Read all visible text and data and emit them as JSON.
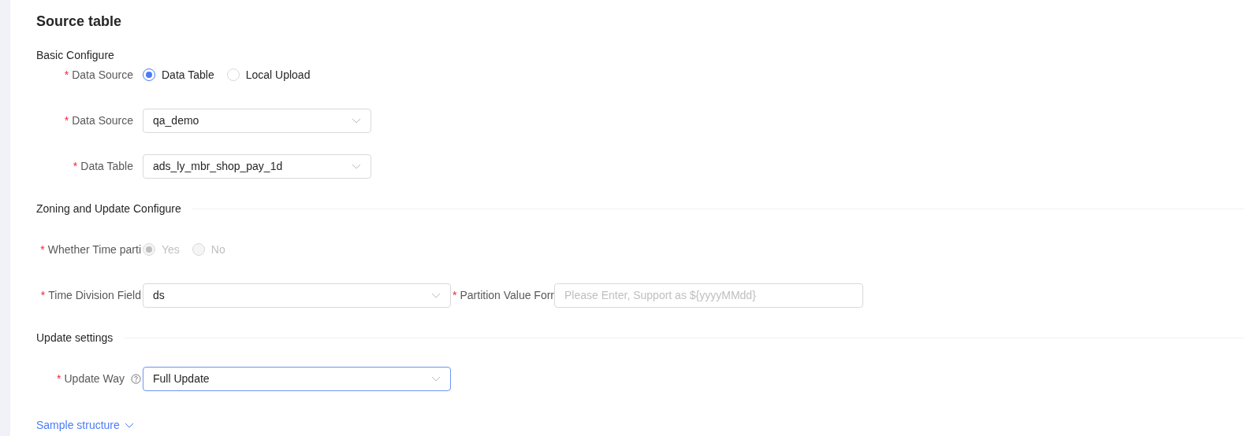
{
  "title": "Source table",
  "sections": [
    {
      "heading": "Basic Configure",
      "divider": false,
      "compact": true,
      "rows": [
        [
          {
            "kind": "radio",
            "label": "Data Source",
            "required": "*",
            "disabled": false,
            "options": [
              {
                "label": "Data Table",
                "selected": true
              },
              {
                "label": "Local Upload",
                "selected": false
              }
            ]
          }
        ],
        [
          {
            "kind": "select",
            "label": "Data Source",
            "required": "*",
            "value": "qa_demo",
            "focused": false
          }
        ],
        [
          {
            "kind": "select",
            "label": "Data Table",
            "required": "*",
            "value": "ads_ly_mbr_shop_pay_1d",
            "focused": false
          }
        ]
      ]
    },
    {
      "heading": "Zoning and Update Configure",
      "divider": true,
      "compact": false,
      "rows": [
        [
          {
            "kind": "radio",
            "label": "Whether Time parti",
            "required": "*",
            "disabled": true,
            "options": [
              {
                "label": "Yes",
                "selected": true
              },
              {
                "label": "No",
                "selected": false
              }
            ]
          }
        ],
        [
          {
            "kind": "select",
            "label": "Time Division Field",
            "required": "*",
            "value": "ds",
            "focused": false
          },
          {
            "kind": "input",
            "label": "Partition Value Forr",
            "required": "*",
            "placeholder": "Please Enter, Support as ${yyyyMMdd}"
          }
        ]
      ]
    },
    {
      "heading": "Update settings",
      "divider": true,
      "compact": false,
      "rows": [
        [
          {
            "kind": "select",
            "label": "Update Way",
            "required": "*",
            "help": true,
            "value": "Full Update",
            "focused": true
          }
        ]
      ]
    }
  ],
  "link": {
    "label": "Sample structure",
    "expanded": false
  }
}
